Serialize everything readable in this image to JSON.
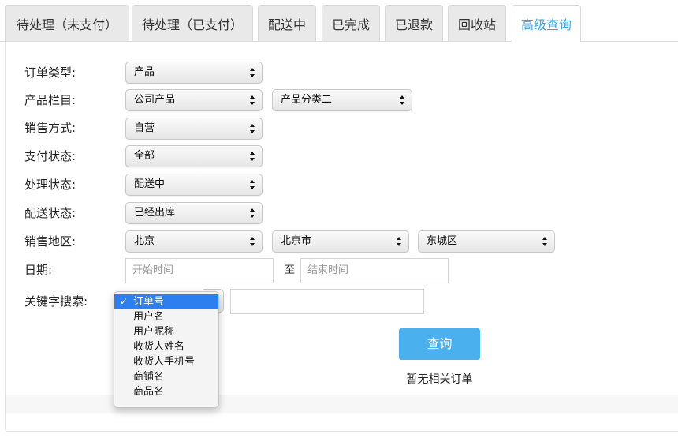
{
  "tabs": [
    {
      "label": "待处理（未支付）"
    },
    {
      "label": "待处理（已支付）"
    },
    {
      "label": "配送中"
    },
    {
      "label": "已完成"
    },
    {
      "label": "已退款"
    },
    {
      "label": "回收站"
    },
    {
      "label": "高级查询",
      "active": true
    }
  ],
  "form": {
    "order_type": {
      "label": "订单类型:",
      "value": "产品"
    },
    "product_column": {
      "label": "产品栏目:",
      "value": "公司产品",
      "sub_value": "产品分类二"
    },
    "sales_mode": {
      "label": "销售方式:",
      "value": "自营"
    },
    "payment_status": {
      "label": "支付状态:",
      "value": "全部"
    },
    "process_status": {
      "label": "处理状态:",
      "value": "配送中"
    },
    "delivery_status": {
      "label": "配送状态:",
      "value": "已经出库"
    },
    "sales_region": {
      "label": "销售地区:",
      "province": "北京",
      "city": "北京市",
      "district": "东城区"
    },
    "date": {
      "label": "日期:",
      "start_placeholder": "开始时间",
      "to_label": "至",
      "end_placeholder": "结束时间"
    },
    "keyword": {
      "label": "关键字搜索:",
      "value": ""
    }
  },
  "keyword_dropdown": {
    "selected_index": 0,
    "options": [
      "订单号",
      "用户名",
      "用户昵称",
      "收货人姓名",
      "收货人手机号",
      "商铺名",
      "商品名"
    ]
  },
  "query_button": "查询",
  "empty_message": "暂无相关订单",
  "colors": {
    "accent": "#4bb0ee",
    "active_tab_text": "#3aa7e8",
    "dropdown_highlight": "#2d7ff0"
  }
}
